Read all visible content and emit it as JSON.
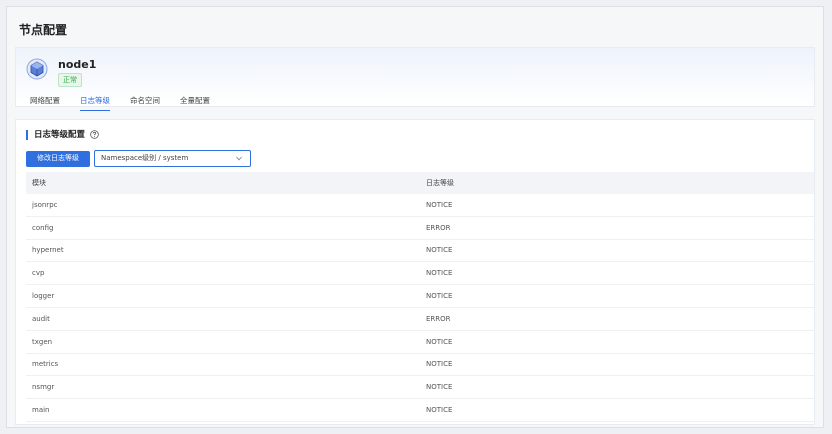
{
  "page": {
    "title": "节点配置"
  },
  "node": {
    "name": "node1",
    "status": "正常",
    "icon": "node-cube-icon"
  },
  "tabs": [
    {
      "label": "网络配置",
      "active": false
    },
    {
      "label": "日志等级",
      "active": true
    },
    {
      "label": "命名空间",
      "active": false
    },
    {
      "label": "全量配置",
      "active": false
    }
  ],
  "log_section": {
    "title": "日志等级配置",
    "help_icon": "question-circle-icon",
    "modify_button": "修改日志等级",
    "namespace_select": "Namespace级别 / system"
  },
  "table": {
    "headers": [
      "模块",
      "日志等级"
    ],
    "rows": [
      [
        "jsonrpc",
        "NOTICE"
      ],
      [
        "config",
        "ERROR"
      ],
      [
        "hypernet",
        "NOTICE"
      ],
      [
        "cvp",
        "NOTICE"
      ],
      [
        "logger",
        "NOTICE"
      ],
      [
        "audit",
        "ERROR"
      ],
      [
        "txgen",
        "NOTICE"
      ],
      [
        "metrics",
        "NOTICE"
      ],
      [
        "nsmgr",
        "NOTICE"
      ],
      [
        "main",
        "NOTICE"
      ]
    ]
  },
  "colors": {
    "accent": "#2f6fe0",
    "status_green": "#2fa84f"
  }
}
